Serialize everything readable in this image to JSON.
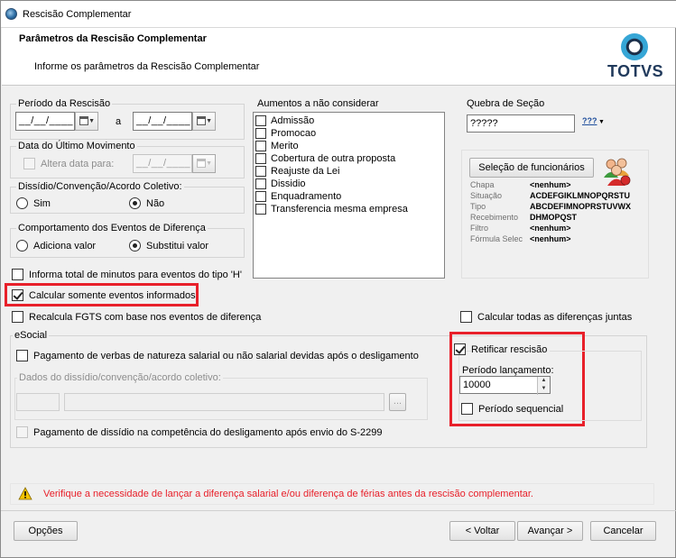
{
  "window": {
    "title": "Rescisão Complementar",
    "logo": "TOTVS"
  },
  "header": {
    "title": "Parâmetros da Rescisão Complementar",
    "subtitle": "Informe os parâmetros da Rescisão Complementar"
  },
  "periodo": {
    "label": "Período da Rescisão",
    "start_value": "__/__/____",
    "separator": "a",
    "end_value": "__/__/____"
  },
  "ultimo_movimento": {
    "label": "Data do Último Movimento",
    "checkbox_label": "Altera data para:",
    "checked": false,
    "date_value": "__/__/____"
  },
  "dissidio": {
    "label": "Dissídio/Convenção/Acordo Coletivo:",
    "options": [
      "Sim",
      "Não"
    ],
    "selected": "Não"
  },
  "comportamento": {
    "label": "Comportamento dos Eventos de Diferença",
    "options": [
      "Adiciona valor",
      "Substitui valor"
    ],
    "selected": "Substitui valor"
  },
  "aumentos": {
    "label": "Aumentos a não considerar",
    "items": [
      "Admissão",
      "Promocao",
      "Merito",
      "Cobertura de outra proposta",
      "Reajuste da Lei",
      "Dissidio",
      "Enquadramento",
      "Transferencia mesma empresa"
    ]
  },
  "quebra": {
    "label": "Quebra de Seção",
    "value": "?????",
    "icon_text": "???"
  },
  "selecao": {
    "button_label": "Seleção de funcionários",
    "rows": [
      {
        "key": "Chapa",
        "value": "<nenhum>"
      },
      {
        "key": "Situação",
        "value": "ACDEFGIKLMNOPQRSTU"
      },
      {
        "key": "Tipo",
        "value": "ABCDEFIMNOPRSTUVWX"
      },
      {
        "key": "Recebimento",
        "value": "DHMOPQST"
      },
      {
        "key": "Filtro",
        "value": "<nenhum>"
      },
      {
        "key": "Fórmula Selec",
        "value": "<nenhum>"
      }
    ]
  },
  "options": {
    "informa_total": {
      "label": "Informa total de minutos para eventos do tipo 'H'",
      "checked": false
    },
    "calcular_somente": {
      "label": "Calcular somente eventos informados",
      "checked": true
    },
    "recalcula_fgts": {
      "label": "Recalcula FGTS com base nos eventos de diferença",
      "checked": false
    },
    "calcular_todas": {
      "label": "Calcular todas as diferenças juntas",
      "checked": false
    }
  },
  "esocial": {
    "label": "eSocial",
    "pagamento_verbas": {
      "label": "Pagamento de verbas de natureza salarial ou não salarial devidas após o desligamento",
      "checked": false
    },
    "dados_dissidio_label": "Dados do dissídio/convenção/acordo coletivo:",
    "browse_label": "...",
    "pagamento_dissidio": {
      "label": "Pagamento de dissídio na competência do desligamento após envio do S-2299",
      "checked": false
    },
    "retificar": {
      "label": "Retificar rescisão",
      "checked": true
    },
    "periodo_lancamento": {
      "label": "Período lançamento:",
      "value": "10000"
    },
    "periodo_sequencial": {
      "label": "Período sequencial",
      "checked": false
    }
  },
  "warning": {
    "text": "Verifique a necessidade de lançar a diferença salarial e/ou diferença de férias antes da rescisão complementar.",
    "color": "#e8202a"
  },
  "footer": {
    "opcoes": "Opções",
    "voltar": "< Voltar",
    "avancar": "Avançar >",
    "cancelar": "Cancelar"
  }
}
